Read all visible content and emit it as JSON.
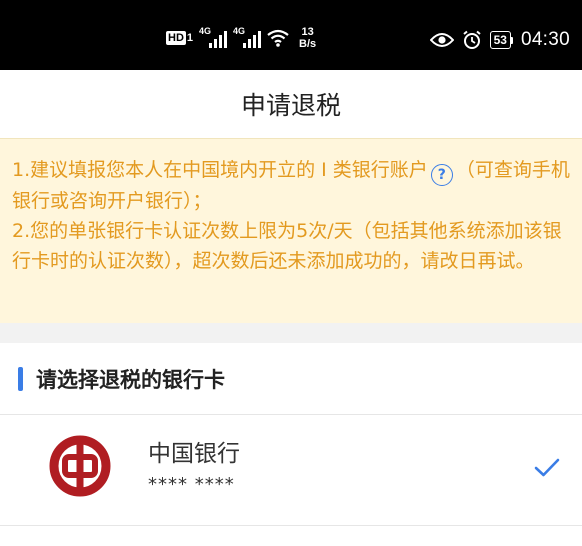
{
  "status_bar": {
    "hd_label": "HD",
    "hd_num": "1",
    "sig1_label": "4G",
    "sig2_label": "4G",
    "speed_value": "13",
    "speed_unit": "B/s",
    "battery": "53",
    "time": "04:30"
  },
  "header": {
    "title": "申请退税"
  },
  "notice": {
    "line1_before": "1.建议填报您本人在中国境内开立的 I 类银行账户",
    "help_icon_glyph": "?",
    "line1_after": "（可查询手机银行或咨询开户银行）；",
    "line2": "2.您的单张银行卡认证次数上限为5次/天（包括其他系统添加该银行卡时的认证次数），超次数后还未添加成功的，请改日再试。"
  },
  "section": {
    "title": "请选择退税的银行卡"
  },
  "bank_card": {
    "bank_name": "中国银行",
    "card_number": "**** ****",
    "logo_icon": "bank-of-china-logo",
    "selected": true
  },
  "colors": {
    "notice_text": "#e39a20",
    "notice_bg": "#fff6dc",
    "accent": "#3a7de6",
    "boc_red": "#b01d22"
  }
}
